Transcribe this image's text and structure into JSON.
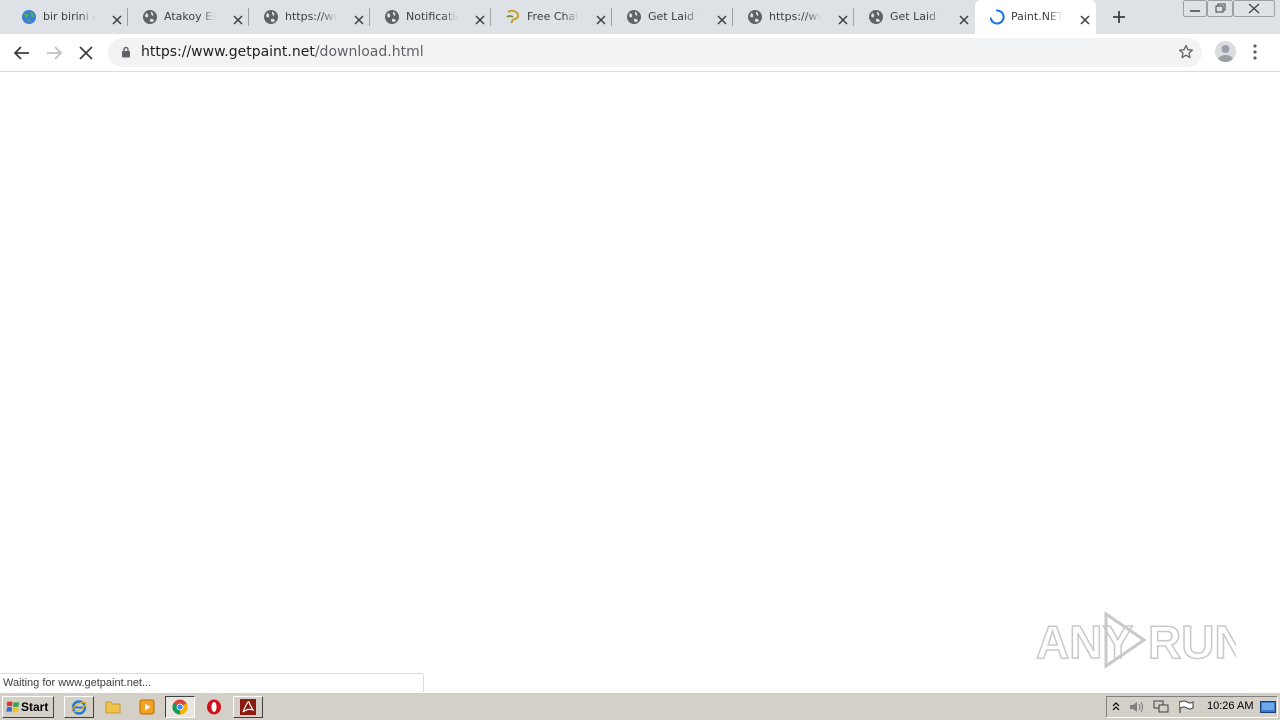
{
  "tabs": [
    {
      "title": "bir birini emmek",
      "favicon": "earth-icon",
      "active": false
    },
    {
      "title": "Atakoy Escort",
      "favicon": "globe-icon",
      "active": false
    },
    {
      "title": "https://www",
      "favicon": "globe-icon",
      "active": false
    },
    {
      "title": "Notification",
      "favicon": "globe-icon",
      "active": false
    },
    {
      "title": "Free Chat w",
      "favicon": "chat-logo-icon",
      "active": false
    },
    {
      "title": "Get Laid Tor",
      "favicon": "globe-icon",
      "active": false
    },
    {
      "title": "https://www",
      "favicon": "globe-icon",
      "active": false
    },
    {
      "title": "Get Laid Tor",
      "favicon": "globe-icon",
      "active": false
    },
    {
      "title": "Paint.NET -",
      "favicon": "loading-spinner-icon",
      "active": true
    }
  ],
  "address_bar": {
    "url_host": "https://www.getpaint.net",
    "url_path": "/download.html"
  },
  "status_bar": {
    "text": "Waiting for www.getpaint.net..."
  },
  "watermark": {
    "text": "ANY RUN"
  },
  "taskbar": {
    "start_label": "Start",
    "clock": "10:26 AM"
  },
  "colors": {
    "tabstrip": "#dee1e6",
    "omnibox": "#f1f3f4",
    "taskbar": "#d4d0c8",
    "spinner": "#1a73e8"
  }
}
